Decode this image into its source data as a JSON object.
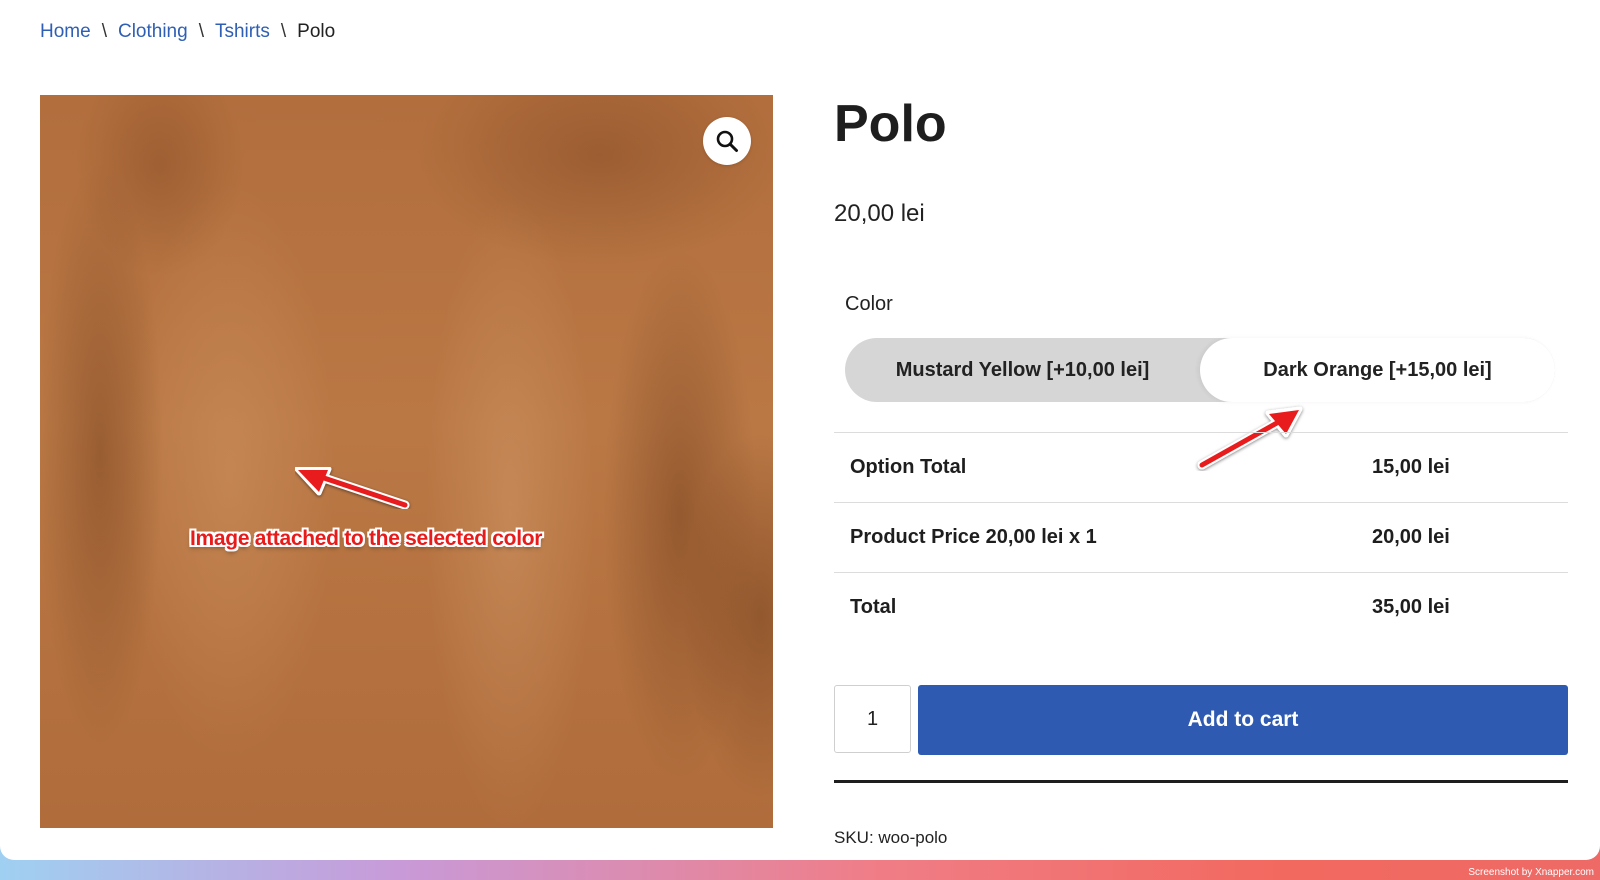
{
  "breadcrumb": {
    "items": [
      "Home",
      "Clothing",
      "Tshirts"
    ],
    "current": "Polo",
    "separator": "\\"
  },
  "image": {
    "annotation": "Image attached to the selected color",
    "zoom_icon": "search-icon"
  },
  "product": {
    "title": "Polo",
    "price": "20,00 lei",
    "color_label": "Color",
    "swatches": [
      {
        "label": "Mustard Yellow [+10,00 lei]",
        "selected": false
      },
      {
        "label": "Dark Orange [+15,00 lei]",
        "selected": true
      }
    ],
    "totals": [
      {
        "label": "Option Total",
        "value": "15,00 lei"
      },
      {
        "label": "Product Price 20,00 lei x 1",
        "value": "20,00 lei"
      },
      {
        "label": "Total",
        "value": "35,00 lei"
      }
    ],
    "quantity": "1",
    "add_to_cart": "Add to cart",
    "sku": "SKU: woo-polo"
  },
  "colors": {
    "link": "#2f5fb4",
    "button": "#2e5bb1",
    "annotation": "#e81b1b",
    "swatch_bg": "#d6d6d6"
  },
  "watermark": "Screenshot by Xnapper.com"
}
